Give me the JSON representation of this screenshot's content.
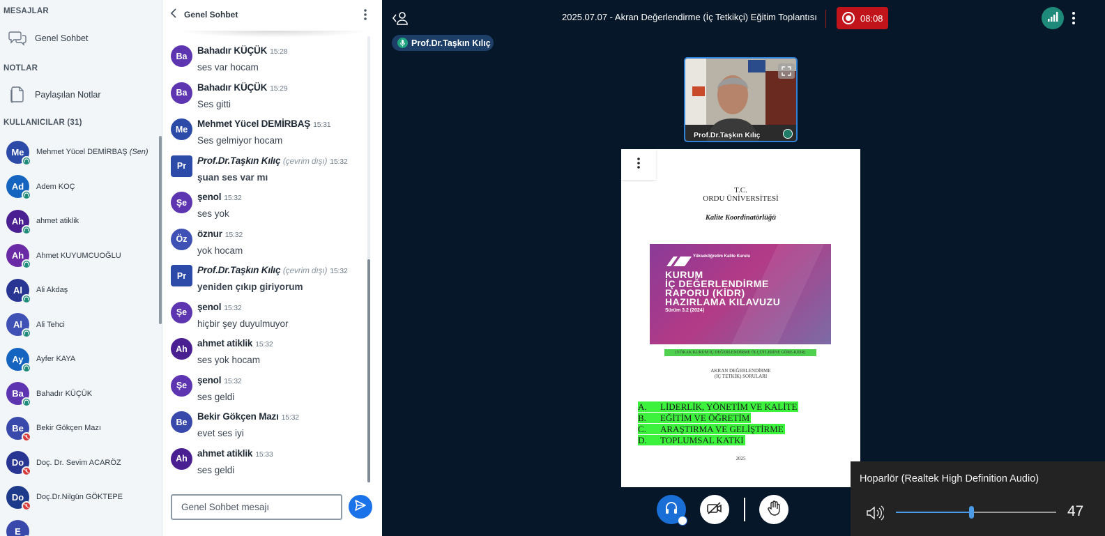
{
  "sidebar": {
    "messages_title": "MESAJLAR",
    "public_chat_label": "Genel Sohbet",
    "notes_title": "NOTLAR",
    "shared_notes_label": "Paylaşılan Notlar",
    "users_title": "KULLANICILAR (31)",
    "you_suffix": "(Sen)",
    "users": [
      {
        "initials": "Me",
        "name": "Mehmet Yücel DEMİRBAŞ",
        "color": "#2c4aa8",
        "audio": "listen"
      },
      {
        "initials": "Ad",
        "name": "Adem KOÇ",
        "color": "#1565c0",
        "audio": "listen"
      },
      {
        "initials": "Ah",
        "name": "ahmet atiklik",
        "color": "#4a1f91",
        "audio": "listen"
      },
      {
        "initials": "Ah",
        "name": "Ahmet KUYUMCUOĞLU",
        "color": "#6a2aa6",
        "audio": "listen"
      },
      {
        "initials": "Al",
        "name": "Ali Akdaş",
        "color": "#283593",
        "audio": "listen"
      },
      {
        "initials": "Al",
        "name": "Ali Tehci",
        "color": "#3f51b5",
        "audio": "listen"
      },
      {
        "initials": "Ay",
        "name": "Ayfer KAYA",
        "color": "#1565c0",
        "audio": "listen"
      },
      {
        "initials": "Ba",
        "name": "Bahadır KÜÇÜK",
        "color": "#5e35b1",
        "audio": "listen"
      },
      {
        "initials": "Be",
        "name": "Bekir Gökçen Mazı",
        "color": "#3949ab",
        "audio": "muted"
      },
      {
        "initials": "Do",
        "name": "Doç. Dr. Sevim ACARÖZ",
        "color": "#283593",
        "audio": "muted"
      },
      {
        "initials": "Do",
        "name": "Doç.Dr.Nilgün GÖKTEPE",
        "color": "#1e3a8a",
        "audio": "muted"
      },
      {
        "initials": "E",
        "name": "",
        "color": "#3949ab",
        "audio": "listen"
      }
    ]
  },
  "chat": {
    "title": "Genel Sohbet",
    "offline_label": "(çevrim dışı)",
    "input_placeholder": "Genel Sohbet mesajı",
    "messages": [
      {
        "initials": "Ba",
        "color": "#5e35b1",
        "shape": "circle",
        "author": "Bahadır KÜÇÜK",
        "time": "15:28",
        "text": "ses var hocam",
        "bold": false,
        "moderator": false
      },
      {
        "initials": "Ba",
        "color": "#5e35b1",
        "shape": "circle",
        "author": "Bahadır KÜÇÜK",
        "time": "15:29",
        "text": "Ses gitti",
        "bold": false,
        "moderator": false
      },
      {
        "initials": "Me",
        "color": "#2c4aa8",
        "shape": "circle",
        "author": "Mehmet Yücel DEMİRBAŞ",
        "time": "15:31",
        "text": "Ses gelmiyor hocam",
        "bold": false,
        "moderator": false
      },
      {
        "initials": "Pr",
        "color": "#2c4aa8",
        "shape": "square",
        "author": "Prof.Dr.Taşkın Kılıç",
        "time": "15:32",
        "text": "şuan ses var mı",
        "bold": true,
        "moderator": true
      },
      {
        "initials": "Şe",
        "color": "#5e35b1",
        "shape": "circle",
        "author": "şenol",
        "time": "15:32",
        "text": "ses yok",
        "bold": false,
        "moderator": false
      },
      {
        "initials": "Öz",
        "color": "#3f51b5",
        "shape": "circle",
        "author": "öznur",
        "time": "15:32",
        "text": "yok hocam",
        "bold": false,
        "moderator": false
      },
      {
        "initials": "Pr",
        "color": "#2c4aa8",
        "shape": "square",
        "author": "Prof.Dr.Taşkın Kılıç",
        "time": "15:32",
        "text": "yeniden çıkıp giriyorum",
        "bold": true,
        "moderator": true
      },
      {
        "initials": "Şe",
        "color": "#5e35b1",
        "shape": "circle",
        "author": "şenol",
        "time": "15:32",
        "text": "hiçbir şey duyulmuyor",
        "bold": false,
        "moderator": false
      },
      {
        "initials": "Ah",
        "color": "#4a1f91",
        "shape": "circle",
        "author": "ahmet atiklik",
        "time": "15:32",
        "text": "ses yok hocam",
        "bold": false,
        "moderator": false
      },
      {
        "initials": "Şe",
        "color": "#5e35b1",
        "shape": "circle",
        "author": "şenol",
        "time": "15:32",
        "text": "ses geldi",
        "bold": false,
        "moderator": false
      },
      {
        "initials": "Be",
        "color": "#3949ab",
        "shape": "circle",
        "author": "Bekir Gökçen Mazı",
        "time": "15:32",
        "text": "evet ses iyi",
        "bold": false,
        "moderator": false
      },
      {
        "initials": "Ah",
        "color": "#4a1f91",
        "shape": "circle",
        "author": "ahmet atiklik",
        "time": "15:33",
        "text": "ses geldi",
        "bold": false,
        "moderator": false
      }
    ]
  },
  "main": {
    "meeting_title": "2025.07.07 - Akran Değerlendirme (İç Tetkikçi) Eğitim Toplantısı",
    "recording_time": "08:08",
    "speaker_name": "Prof.Dr.Taşkın Kılıç",
    "video_name": "Prof.Dr.Taşkın Kılıç",
    "colors": {
      "accent": "#1a6fd6",
      "record": "#c0141a",
      "connection": "#1e8a7a",
      "background": "#06172a"
    }
  },
  "slide": {
    "line1": "T.C.",
    "line2": "ORDU ÜNİVERSİTESİ",
    "line3": "Kalite Koordinatörlüğü",
    "cover_logo_text": "Yükseköğretim Kalite Kurulu",
    "cover_title_lines": [
      "KURUM",
      "İÇ DEĞERLENDİRME",
      "RAPORU (KİDR)",
      "HAZIRLAMA KILAVUZU"
    ],
    "cover_version": "Sürüm 3.2 (2024)",
    "highlight_caption": "(YÖKAK KURUM İÇ DEĞERLENDİRME ÖLÇÜTLERİNE GÖRE-KİDR)",
    "sub1": "AKRAN DEĞERLENDİRME",
    "sub2": "(İÇ TETKİK) SORULARI",
    "sections": [
      {
        "letter": "A.",
        "text": "LİDERLİK, YÖNETİM VE KALİTE"
      },
      {
        "letter": "B.",
        "text": "EĞİTİM VE ÖĞRETİM"
      },
      {
        "letter": "C.",
        "text": "ARAŞTIRMA VE GELİŞTİRME"
      },
      {
        "letter": "D.",
        "text": "TOPLUMSAL KATKI"
      }
    ],
    "year": "2025"
  },
  "audio_panel": {
    "device": "Hoparlör (Realtek High Definition Audio)",
    "volume": "47",
    "volume_fraction": 0.47
  }
}
